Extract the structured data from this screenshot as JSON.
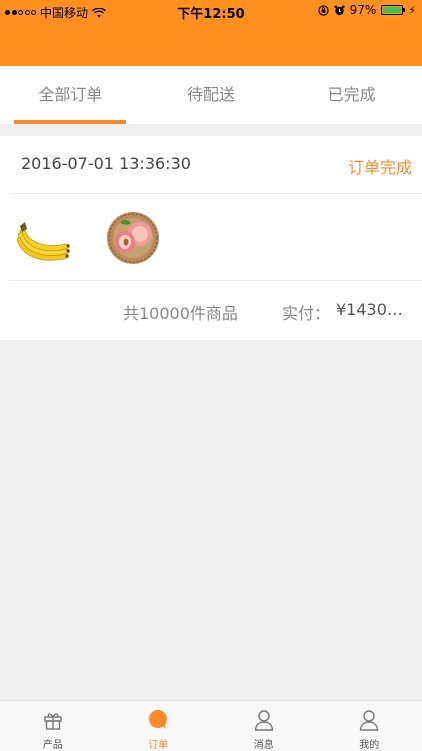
{
  "status_bar": {
    "carrier": "中国移动",
    "time": "下午12:50",
    "battery": "97%"
  },
  "tabs": [
    {
      "label": "全部订单",
      "active": true
    },
    {
      "label": "待配送",
      "active": false
    },
    {
      "label": "已完成",
      "active": false
    }
  ],
  "order": {
    "time": "2016-07-01 13:36:30",
    "status": "订单完成",
    "products": [
      {
        "name": "banana",
        "icon": "banana-image"
      },
      {
        "name": "peach",
        "icon": "peach-basket-image"
      }
    ],
    "count_text": "共10000件商品",
    "paid_label": "实付：",
    "paid_amount": "¥14300..."
  },
  "tabbar": [
    {
      "label": "产品",
      "icon": "gift-icon",
      "active": false
    },
    {
      "label": "订单",
      "icon": "chat-bubble-icon",
      "active": true
    },
    {
      "label": "消息",
      "icon": "user-icon",
      "active": false
    },
    {
      "label": "我的",
      "icon": "user-icon",
      "active": false
    }
  ],
  "colors": {
    "accent": "#ff8a2b",
    "header": "#ff8f1f",
    "background": "#efefef"
  }
}
